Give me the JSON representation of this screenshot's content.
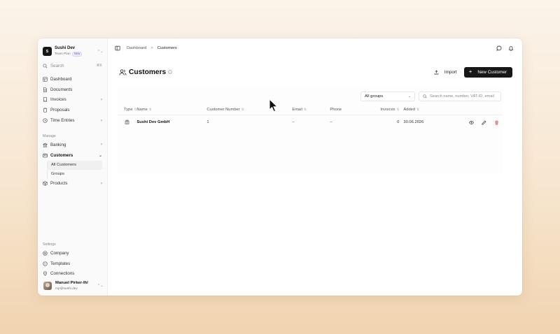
{
  "sidebar": {
    "team_initial": "S",
    "team_name": "Sushi Dev",
    "team_plan": "Team Plan",
    "plan_badge": "New",
    "search_label": "Search",
    "search_shortcut": "⌘K",
    "nav": [
      {
        "label": "Dashboard",
        "icon": "dashboard-icon"
      },
      {
        "label": "Documents",
        "icon": "document-icon"
      },
      {
        "label": "Invoices",
        "icon": "invoice-icon"
      },
      {
        "label": "Proposals",
        "icon": "proposal-icon"
      },
      {
        "label": "Time Entries",
        "icon": "clock-icon"
      }
    ],
    "manage_label": "Manage",
    "manage": [
      {
        "label": "Banking",
        "icon": "bank-icon"
      },
      {
        "label": "Customers",
        "icon": "customers-icon"
      },
      {
        "label": "All Customers"
      },
      {
        "label": "Groups"
      },
      {
        "label": "Products",
        "icon": "product-icon"
      }
    ],
    "settings_label": "Settings",
    "settings": [
      {
        "label": "Company",
        "icon": "company-icon"
      },
      {
        "label": "Templates",
        "icon": "template-icon"
      },
      {
        "label": "Connections",
        "icon": "connection-icon"
      }
    ],
    "user_name": "Manuel Pirker-Ihl",
    "user_email": "mp@sushi.dev"
  },
  "topbar": {
    "breadcrumb_root": "Dashboard",
    "breadcrumb_sep": ">",
    "breadcrumb_current": "Customers"
  },
  "header": {
    "title": "Customers",
    "import_label": "Import",
    "new_label": "New Customer"
  },
  "filters": {
    "group_selected": "All groups",
    "search_placeholder": "Search name, number, VAT-ID, email"
  },
  "table": {
    "columns": [
      "Type",
      "Name",
      "Customer Number",
      "Email",
      "Phone",
      "Invoices",
      "Added"
    ],
    "rows": [
      {
        "type_icon": "building-icon",
        "name": "Sushi Dev GmbH",
        "number": "1",
        "email": "–",
        "phone": "–",
        "invoices": "0",
        "added": "30.06.2026"
      }
    ]
  },
  "colors": {
    "accent_dark": "#171717",
    "delete_red": "#e0474c",
    "badge_purple": "#6b5bd6"
  }
}
